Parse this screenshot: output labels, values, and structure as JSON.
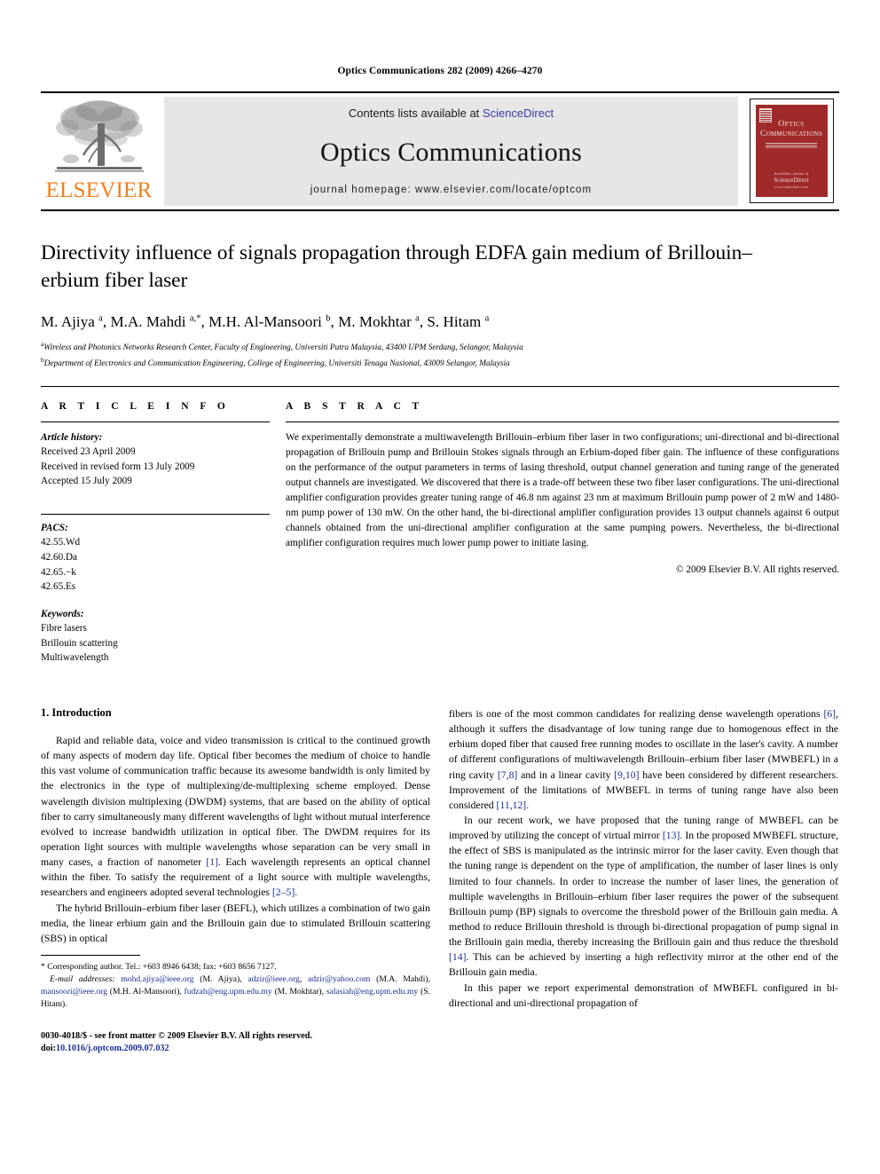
{
  "running_head": "Optics Communications 282 (2009) 4266–4270",
  "masthead": {
    "publisher_name": "ELSEVIER",
    "contents_prefix": "Contents lists available at ",
    "contents_link": "ScienceDirect",
    "journal_title": "Optics Communications",
    "homepage_line": "journal homepage: www.elsevier.com/locate/optcom",
    "cover": {
      "line1": "Optics",
      "line2": "Communications",
      "foot1": "Available online at",
      "foot2": "ScienceDirect",
      "foot3": "www.sciencedirect.com"
    }
  },
  "article": {
    "title": "Directivity influence of signals propagation through EDFA gain medium of Brillouin–erbium fiber laser",
    "authors_html": "M. Ajiya <sup>a</sup>, M.A. Mahdi <sup>a,*</sup>, M.H. Al-Mansoori <sup>b</sup>, M. Mokhtar <sup>a</sup>, S. Hitam <sup>a</sup>",
    "affiliation_a": "Wireless and Photonics Networks Research Center, Faculty of Engineering, Universiti Putra Malaysia, 43400 UPM Serdang, Selangor, Malaysia",
    "affiliation_b": "Department of Electronics and Communication Engineering, College of Engineering, Universiti Tenaga Nasional, 43009 Selangor, Malaysia"
  },
  "article_info": {
    "heading": "A R T I C L E   I N F O",
    "history_label": "Article history:",
    "history": [
      "Received 23 April 2009",
      "Received in revised form 13 July 2009",
      "Accepted 15 July 2009"
    ],
    "pacs_label": "PACS:",
    "pacs": [
      "42.55.Wd",
      "42.60.Da",
      "42.65.−k",
      "42.65.Es"
    ],
    "keywords_label": "Keywords:",
    "keywords": [
      "Fibre lasers",
      "Brillouin scattering",
      "Multiwavelength"
    ]
  },
  "abstract": {
    "heading": "A B S T R A C T",
    "text": "We experimentally demonstrate a multiwavelength Brillouin–erbium fiber laser in two configurations; uni-directional and bi-directional propagation of Brillouin pump and Brillouin Stokes signals through an Erbium-doped fiber gain. The influence of these configurations on the performance of the output parameters in terms of lasing threshold, output channel generation and tuning range of the generated output channels are investigated. We discovered that there is a trade-off between these two fiber laser configurations. The uni-directional amplifier configuration provides greater tuning range of 46.8 nm against 23 nm at maximum Brillouin pump power of 2 mW and 1480-nm pump power of 130 mW. On the other hand, the bi-directional amplifier configuration provides 13 output channels against 6 output channels obtained from the uni-directional amplifier configuration at the same pumping powers. Nevertheless, the bi-directional amplifier configuration requires much lower pump power to initiate lasing.",
    "copyright": "© 2009 Elsevier B.V. All rights reserved."
  },
  "body": {
    "section_title": "1. Introduction",
    "left_paragraphs": [
      "Rapid and reliable data, voice and video transmission is critical to the continued growth of many aspects of modern day life. Optical fiber becomes the medium of choice to handle this vast volume of communication traffic because its awesome bandwidth is only limited by the electronics in the type of multiplexing/de-multiplexing scheme employed. Dense wavelength division multiplexing (DWDM) systems, that are based on the ability of optical fiber to carry simultaneously many different wavelengths of light without mutual interference evolved to increase bandwidth utilization in optical fiber. The DWDM requires for its operation light sources with multiple wavelengths whose separation can be very small in many cases, a fraction of nanometer [1]. Each wavelength represents an optical channel within the fiber. To satisfy the requirement of a light source with multiple wavelengths, researchers and engineers adopted several technologies [2–5].",
      "The hybrid Brillouin–erbium fiber laser (BEFL), which utilizes a combination of two gain media, the linear erbium gain and the Brillouin gain due to stimulated Brillouin scattering (SBS) in optical"
    ],
    "right_paragraphs": [
      "fibers is one of the most common candidates for realizing dense wavelength operations [6], although it suffers the disadvantage of low tuning range due to homogenous effect in the erbium doped fiber that caused free running modes to oscillate in the laser's cavity. A number of different configurations of multiwavelength Brillouin–erbium fiber laser (MWBEFL) in a ring cavity [7,8] and in a linear cavity [9,10] have been considered by different researchers. Improvement of the limitations of MWBEFL in terms of tuning range have also been considered [11,12].",
      "In our recent work, we have proposed that the tuning range of MWBEFL can be improved by utilizing the concept of virtual mirror [13]. In the proposed MWBEFL structure, the effect of SBS is manipulated as the intrinsic mirror for the laser cavity. Even though that the tuning range is dependent on the type of amplification, the number of laser lines is only limited to four channels. In order to increase the number of laser lines, the generation of multiple wavelengths in Brillouin–erbium fiber laser requires the power of the subsequent Brillouin pump (BP) signals to overcome the threshold power of the Brillouin gain media. A method to reduce Brillouin threshold is through bi-directional propagation of pump signal in the Brillouin gain media, thereby increasing the Brillouin gain and thus reduce the threshold [14]. This can be achieved by inserting a high reflectivity mirror at the other end of the Brillouin gain media.",
      "In this paper we report experimental demonstration of MWBEFL configured in bi-directional and uni-directional propagation of"
    ]
  },
  "footnote": {
    "corresponding": "* Corresponding author. Tel.: +603 8946 6438; fax: +603 8656 7127.",
    "email_label": "E-mail addresses:",
    "emails_text": "mohd.ajiya@ieee.org (M. Ajiya), adzir@ieee.org, adzir@yahoo.com (M.A. Mahdi), mansoori@ieee.org (M.H. Al-Mansoori), fudzah@eng.upm.edu.my (M. Mokhtar), salasiah@eng.upm.edu.my (S. Hitam)."
  },
  "imprint": {
    "line1": "0030-4018/$ - see front matter © 2009 Elsevier B.V. All rights reserved.",
    "doi_label": "doi:",
    "doi_value": "10.1016/j.optcom.2009.07.032"
  },
  "colors": {
    "link_blue": "#3a3aa8",
    "reference_blue": "#1a2f93",
    "elsevier_orange": "#F07F1A",
    "cover_red": "#A02A2A",
    "banner_grey": "#e6e6e6"
  }
}
